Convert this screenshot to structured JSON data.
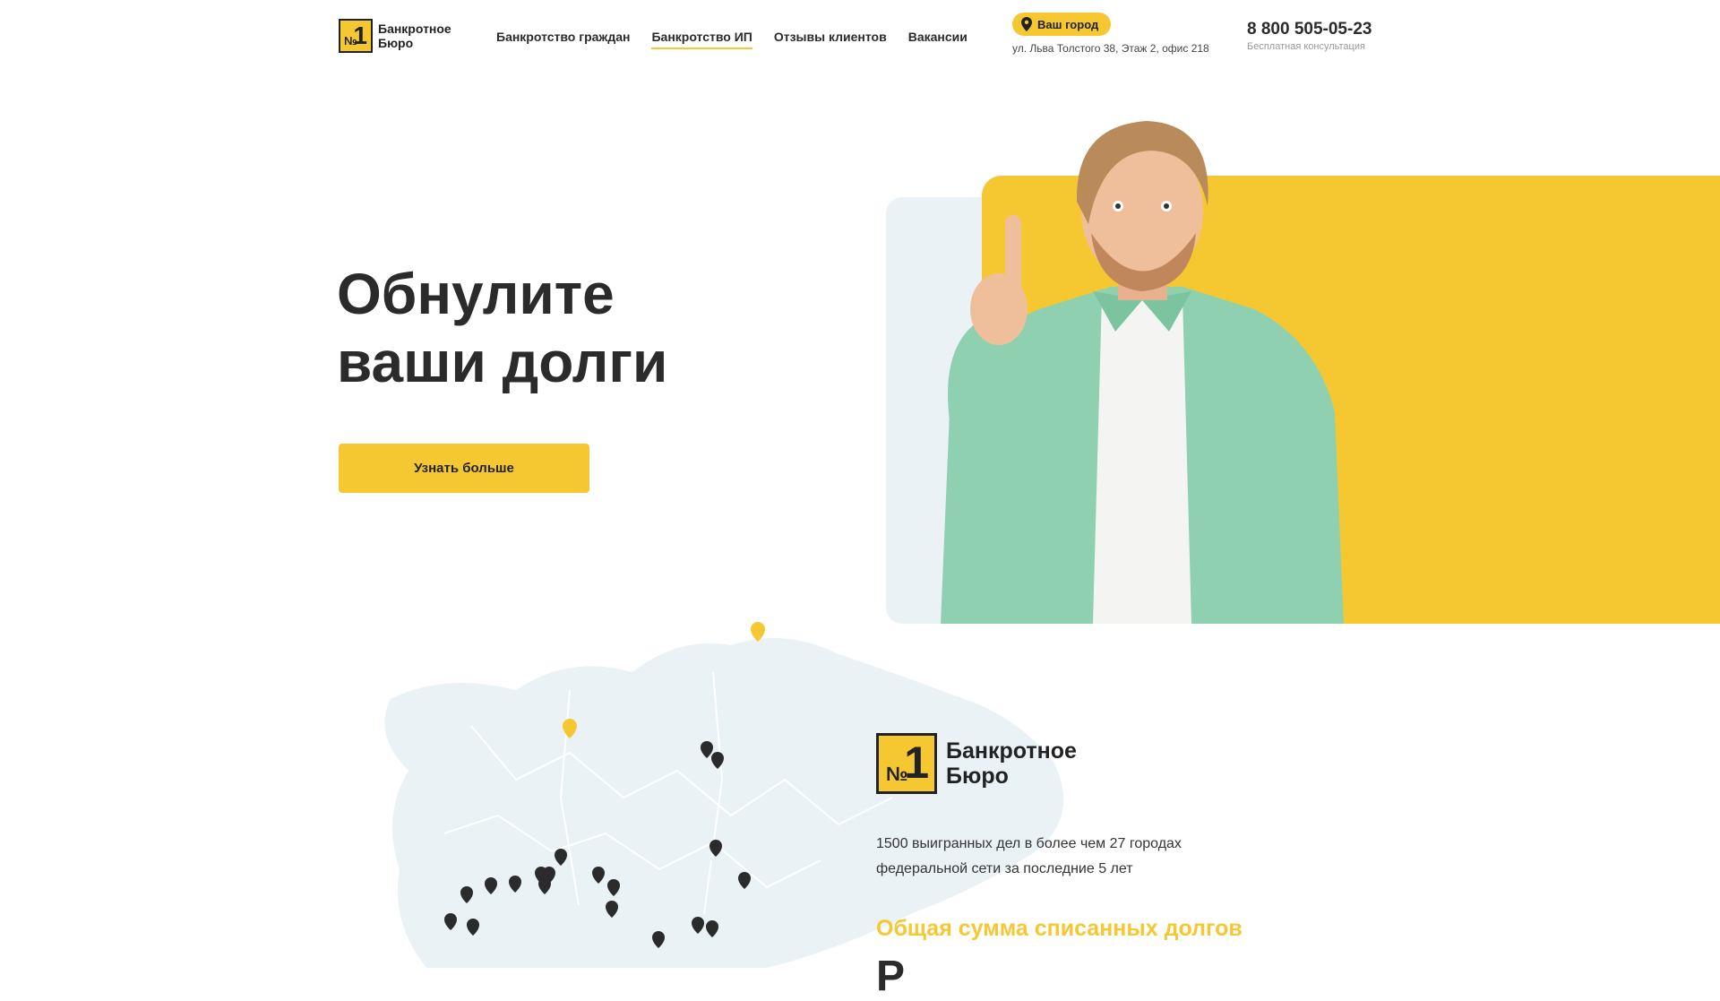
{
  "header": {
    "logo_line1": "Банкротное",
    "logo_line2": "Бюро",
    "logo_no": "№",
    "logo_one": "1",
    "nav": [
      {
        "label": "Банкротство граждан",
        "active": false
      },
      {
        "label": "Банкротство ИП",
        "active": true
      },
      {
        "label": "Отзывы клиентов",
        "active": false
      },
      {
        "label": "Вакансии",
        "active": false
      }
    ],
    "city_button": "Ваш город",
    "address": "ул. Льва Толстого 38, Этаж 2, офис 218",
    "phone": "8 800 505-05-23",
    "phone_sub": "Бесплатная консультация"
  },
  "hero": {
    "title_line1": "Обнулите",
    "title_line2": "ваши долги",
    "cta": "Узнать больше"
  },
  "about": {
    "logo_line1": "Банкротное",
    "logo_line2": "Бюро",
    "stat_line1": "1500 выигранных дел в более чем 27 городах",
    "stat_line2": "федеральной сети за последние 5 лет",
    "sum_title": "Общая сумма списанных долгов",
    "sum_value_partial": "Р"
  },
  "colors": {
    "accent": "#f5c832",
    "text": "#2b2b2b",
    "map_fill": "#eaf2f6",
    "pin_dark": "#2b2b2b"
  }
}
